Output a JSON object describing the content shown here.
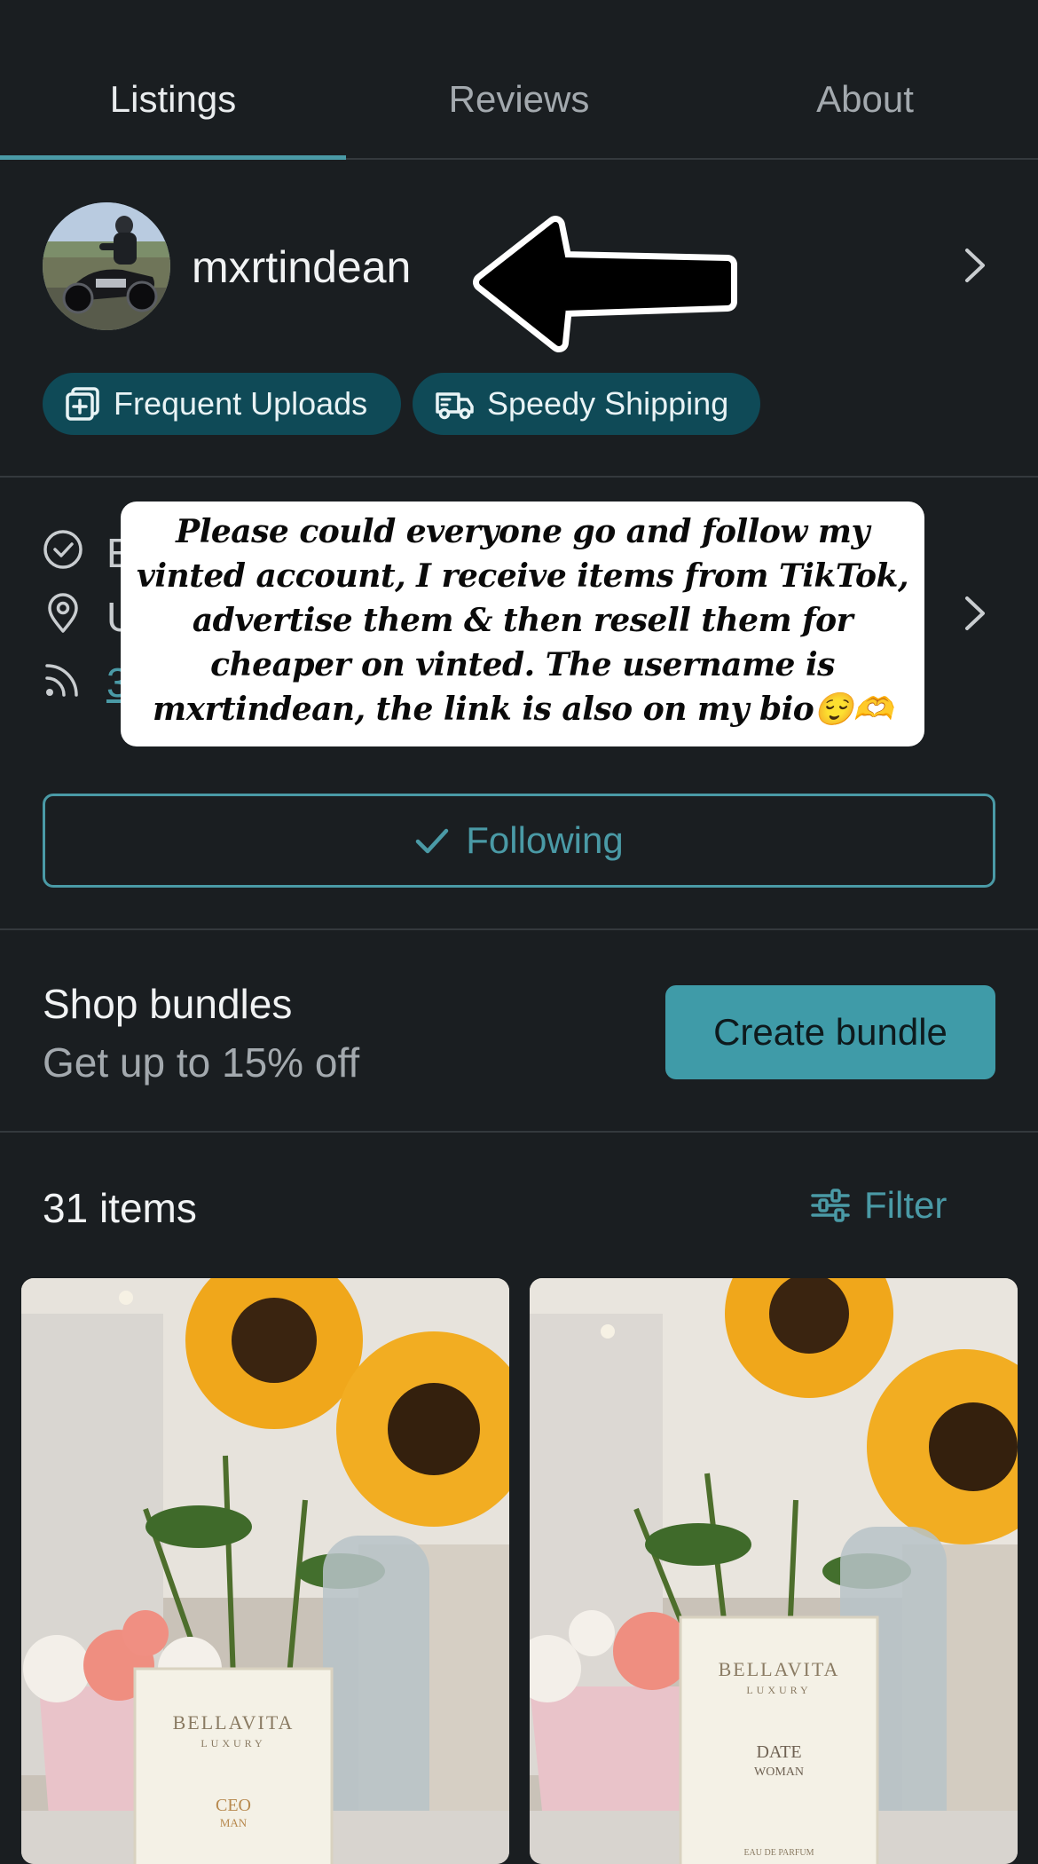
{
  "tabs": [
    {
      "label": "Listings",
      "active": true
    },
    {
      "label": "Reviews",
      "active": false
    },
    {
      "label": "About",
      "active": false
    }
  ],
  "profile": {
    "username": "mxrtindean",
    "badges": [
      {
        "label": "Frequent Uploads",
        "icon": "upload-plus-icon"
      },
      {
        "label": "Speedy Shipping",
        "icon": "truck-icon"
      }
    ]
  },
  "overlay_caption": "Please could everyone go and follow my vinted account, I receive items from TikTok, advertise them & then resell them for cheaper on vinted. The username is mxrtindean, the link is also on my bio😌🫶",
  "info_rows": [
    {
      "icon": "check-circle-icon",
      "text": "En"
    },
    {
      "icon": "location-pin-icon",
      "text": "U"
    },
    {
      "icon": "rss-feed-icon",
      "text": "3"
    }
  ],
  "follow_button": {
    "label": "Following",
    "icon": "checkmark-icon"
  },
  "bundles": {
    "title": "Shop bundles",
    "subtitle": "Get up to 15% off",
    "button_label": "Create bundle"
  },
  "items": {
    "count_label": "31 items",
    "filter_label": "Filter"
  },
  "products": [
    {
      "brand": "BELLAVITA",
      "line": "LUXURY",
      "name": "CEO",
      "variant": "MAN"
    },
    {
      "brand": "BELLAVITA",
      "line": "LUXURY",
      "name": "DATE",
      "variant": "WOMAN",
      "note": "EAU DE PARFUM"
    }
  ],
  "colors": {
    "background": "#1a1e21",
    "accent": "#4a9aa6",
    "chip_bg": "#0f4a57",
    "button_fill": "#3f9ba8"
  }
}
